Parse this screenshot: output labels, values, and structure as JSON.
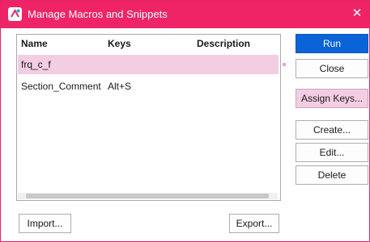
{
  "window": {
    "title": "Manage Macros and Snippets",
    "close_glyph": "✕",
    "icon": "macro-app-icon"
  },
  "list": {
    "columns": [
      "Name",
      "Keys",
      "Description"
    ],
    "rows": [
      {
        "name": "frq_c_f",
        "keys": "",
        "description": ""
      },
      {
        "name": "Section_Comment",
        "keys": "Alt+S",
        "description": ""
      }
    ],
    "selected_index": 0
  },
  "buttons": {
    "run": "Run",
    "close": "Close",
    "assign_keys": "Assign Keys...",
    "create": "Create...",
    "edit": "Edit...",
    "delete": "Delete",
    "import": "Import...",
    "export": "Export..."
  },
  "colors": {
    "accent": "#ee2466",
    "primary_button": "#0a64d8",
    "selection": "#f3cde2"
  }
}
